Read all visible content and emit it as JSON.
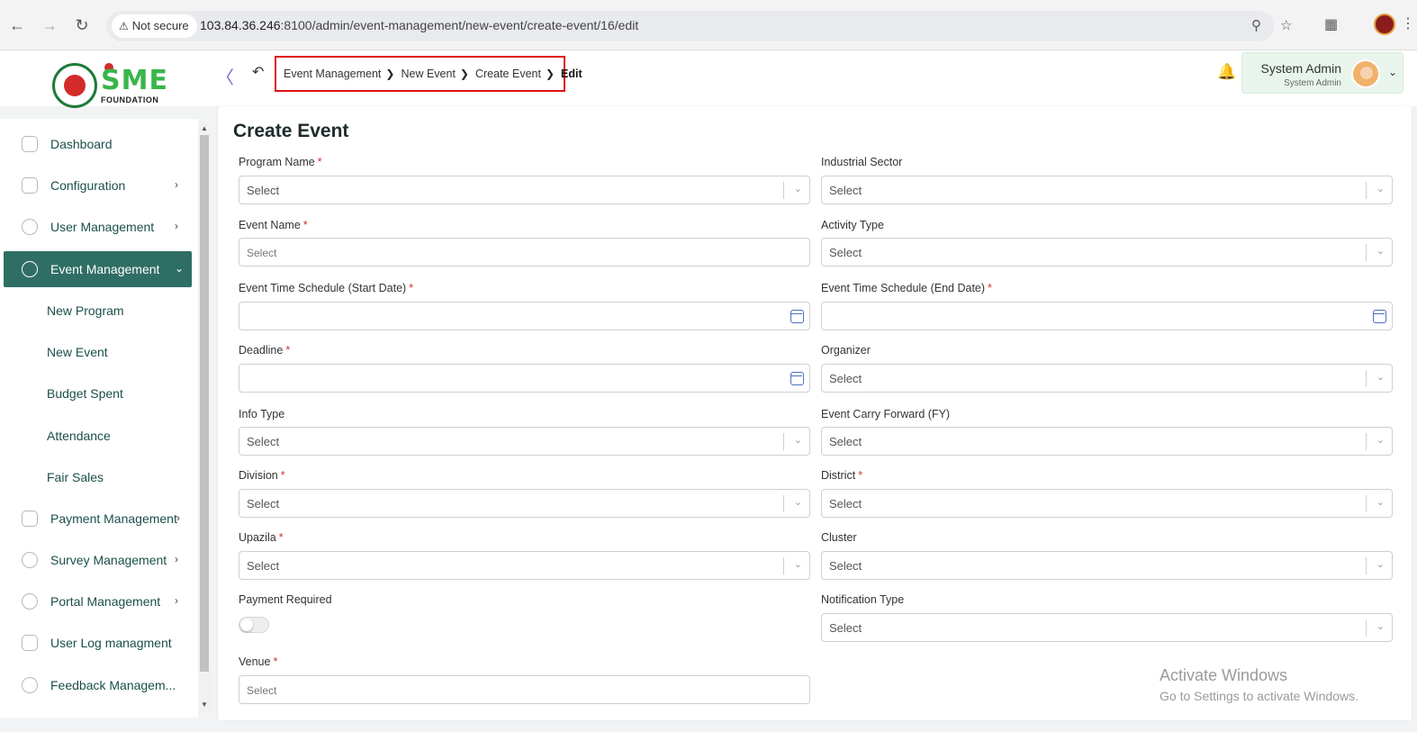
{
  "browser": {
    "security_label": "Not secure",
    "url_host": "103.84.36.246",
    "url_rest": ":8100/admin/event-management/new-event/create-event/16/edit"
  },
  "header": {
    "breadcrumb": [
      "Event Management",
      "New Event",
      "Create Event",
      "Edit"
    ],
    "user_name": "System Admin",
    "user_role": "System Admin"
  },
  "logo": {
    "text": "SME",
    "subtext": "FOUNDATION"
  },
  "sidebar": {
    "items": [
      {
        "label": "Dashboard",
        "icon": "grid-icon",
        "has_children": false
      },
      {
        "label": "Configuration",
        "icon": "config-icon",
        "has_children": true
      },
      {
        "label": "User Management",
        "icon": "user-icon",
        "has_children": true
      },
      {
        "label": "Event Management",
        "icon": "event-icon",
        "has_children": true,
        "active": true
      },
      {
        "label": "Payment Management",
        "icon": "payment-icon",
        "has_children": true
      },
      {
        "label": "Survey Management",
        "icon": "survey-icon",
        "has_children": true
      },
      {
        "label": "Portal Management",
        "icon": "portal-icon",
        "has_children": true
      },
      {
        "label": "User Log managment",
        "icon": "log-icon",
        "has_children": false
      },
      {
        "label": "Feedback Managem...",
        "icon": "feedback-icon",
        "has_children": false
      }
    ],
    "sub_items": [
      "New Program",
      "New Event",
      "Budget Spent",
      "Attendance",
      "Fair Sales"
    ]
  },
  "form": {
    "title": "Create Event",
    "fields": {
      "program_name": {
        "label": "Program Name",
        "required": true,
        "placeholder": "Select"
      },
      "industrial_sector": {
        "label": "Industrial Sector",
        "required": false,
        "placeholder": "Select"
      },
      "event_name": {
        "label": "Event Name",
        "required": true,
        "placeholder": "Select"
      },
      "activity_type": {
        "label": "Activity Type",
        "required": false,
        "placeholder": "Select"
      },
      "start_date": {
        "label": "Event Time Schedule (Start Date)",
        "required": true,
        "value": ""
      },
      "end_date": {
        "label": "Event Time Schedule (End Date)",
        "required": true,
        "value": ""
      },
      "deadline": {
        "label": "Deadline",
        "required": true,
        "value": ""
      },
      "organizer": {
        "label": "Organizer",
        "required": false,
        "placeholder": "Select"
      },
      "info_type": {
        "label": "Info Type",
        "required": false,
        "placeholder": "Select"
      },
      "carry_forward": {
        "label": "Event Carry Forward (FY)",
        "required": false,
        "placeholder": "Select"
      },
      "division": {
        "label": "Division",
        "required": true,
        "placeholder": "Select"
      },
      "district": {
        "label": "District",
        "required": true,
        "placeholder": "Select"
      },
      "upazila": {
        "label": "Upazila",
        "required": true,
        "placeholder": "Select"
      },
      "cluster": {
        "label": "Cluster",
        "required": false,
        "placeholder": "Select"
      },
      "payment_required": {
        "label": "Payment Required",
        "required": false,
        "value": false
      },
      "notification_type": {
        "label": "Notification Type",
        "required": false,
        "placeholder": "Select"
      },
      "venue": {
        "label": "Venue",
        "required": true,
        "placeholder": "Select"
      }
    }
  },
  "watermark": {
    "title": "Activate Windows",
    "subtitle": "Go to Settings to activate Windows."
  },
  "colors": {
    "sidebar_active": "#2f6e64",
    "breadcrumb_highlight": "#e01010",
    "required_mark": "#d32f2f"
  }
}
